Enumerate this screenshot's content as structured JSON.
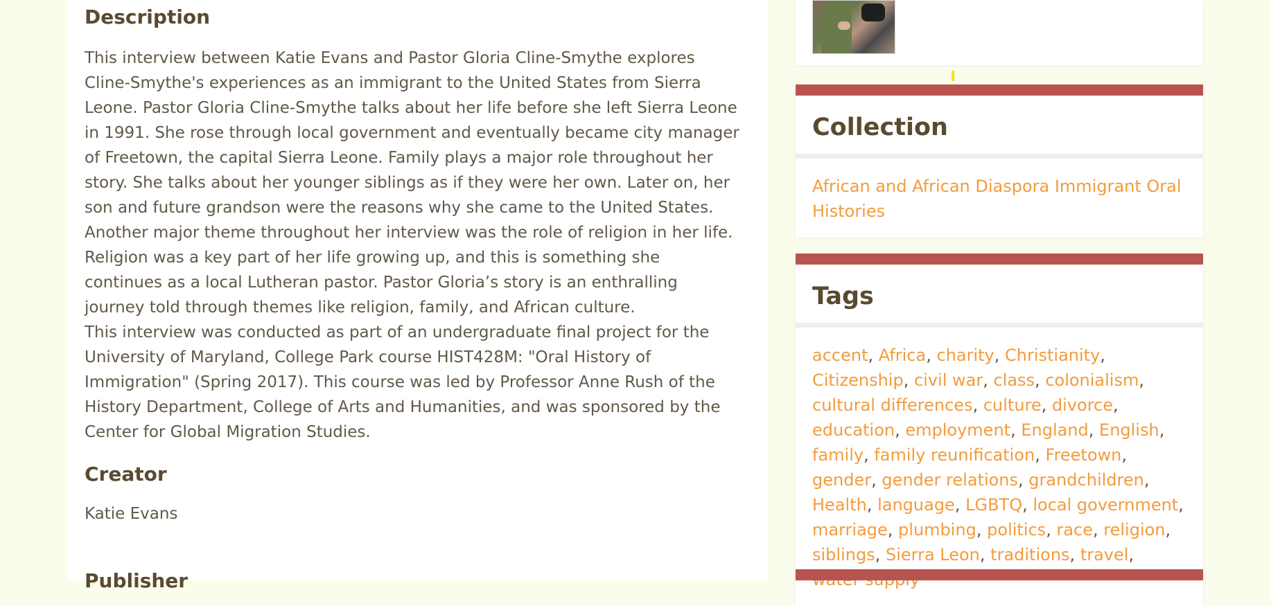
{
  "description": {
    "heading": "Description",
    "paragraph1": "This interview between Katie Evans and Pastor Gloria Cline-Smythe explores Cline-Smythe's experiences as an immigrant to the United States from Sierra Leone. Pastor Gloria Cline-Smythe talks about her life before she left Sierra Leone in 1991. She rose through local government and eventually became city manager of Freetown, the capital Sierra Leone. Family plays a major role throughout her story. She talks about her younger siblings as if they were her own. Later on, her son and future grandson were the reasons why she came to the United States. Another major theme throughout her interview was the role of religion in her life. Religion was a key part of her life growing up, and this is something she continues as a local Lutheran pastor. Pastor Gloria’s story is an enthralling journey told through themes like religion, family, and African culture.",
    "paragraph2": "This interview was conducted as part of an undergraduate final project for the University of Maryland, College Park course HIST428M: \"Oral History of Immigration\" (Spring 2017). This course was led by Professor Anne Rush of the History Department, College of Arts and Humanities, and was sponsored by the Center for Global Migration Studies."
  },
  "creator": {
    "heading": "Creator",
    "value": "Katie Evans"
  },
  "publisher": {
    "heading": "Publisher"
  },
  "sidebar": {
    "collection": {
      "title": "Collection",
      "link": "African and African Diaspora Immigrant Oral Histories"
    },
    "tags": {
      "title": "Tags",
      "items": [
        "accent",
        "Africa",
        "charity",
        "Christianity",
        "Citizenship",
        "civil war",
        "class",
        "colonialism",
        "cultural differences",
        "culture",
        "divorce",
        "education",
        "employment",
        "England",
        "English",
        "family",
        "family reunification",
        "Freetown",
        "gender",
        "gender relations",
        "grandchildren",
        "Health",
        "language",
        "LGBTQ",
        "local government",
        "marriage",
        "plumbing",
        "politics",
        "race",
        "religion",
        "siblings",
        "Sierra Leon",
        "traditions",
        "travel",
        "water supply"
      ]
    }
  },
  "colors": {
    "background": "#fafdec",
    "accent_bar": "#b85450",
    "link": "#f39c3c",
    "heading": "#5a4a30",
    "body_text": "#615848"
  }
}
